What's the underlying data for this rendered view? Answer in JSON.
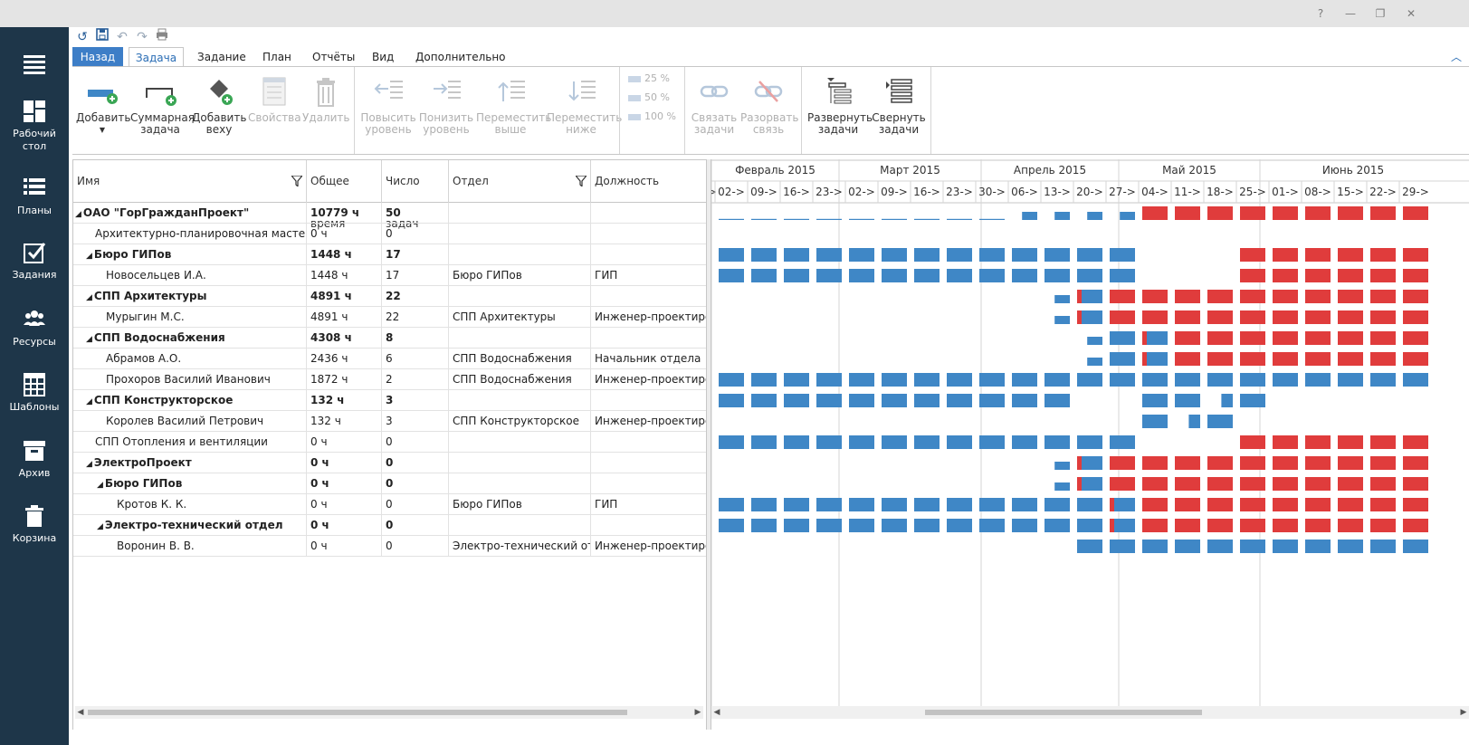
{
  "window": {
    "help_glyph": "?",
    "minimize_glyph": "—",
    "restore_glyph": "❐",
    "close_glyph": "✕"
  },
  "sidebar": {
    "items": [
      {
        "label": "",
        "icon": "hamburger-menu-icon"
      },
      {
        "label": "Рабочий стол",
        "icon": "dashboard-icon"
      },
      {
        "label": "Планы",
        "icon": "list-icon"
      },
      {
        "label": "Задания",
        "icon": "checkbox-icon"
      },
      {
        "label": "Ресурсы",
        "icon": "people-icon"
      },
      {
        "label": "Шаблоны",
        "icon": "table-template-icon"
      },
      {
        "label": "Архив",
        "icon": "archive-icon"
      },
      {
        "label": "Корзина",
        "icon": "trash-icon"
      }
    ]
  },
  "quick_access": [
    "refresh-icon",
    "save-icon",
    "undo-icon",
    "redo-icon",
    "print-icon"
  ],
  "tabs": {
    "back": "Назад",
    "items": [
      "Задача",
      "Задание",
      "План",
      "Отчёты",
      "Вид",
      "Дополнительно"
    ],
    "active": "Задача"
  },
  "ribbon": {
    "add": "Добавить",
    "summary_task_1": "Суммарная",
    "summary_task_2": "задача",
    "add_milestone_1": "Добавить",
    "add_milestone_2": "веху",
    "properties": "Свойства",
    "delete": "Удалить",
    "indent_1": "Повысить",
    "indent_2": "уровень",
    "outdent_1": "Понизить",
    "outdent_2": "уровень",
    "move_up_1": "Переместить",
    "move_up_2": "выше",
    "move_down_1": "Переместить",
    "move_down_2": "ниже",
    "pct_25": "25 %",
    "pct_50": "50 %",
    "pct_100": "100 %",
    "link_1": "Связать",
    "link_2": "задачи",
    "unlink_1": "Разорвать",
    "unlink_2": "связь",
    "expand_1": "Развернуть",
    "expand_2": "задачи",
    "collapse_1": "Свернуть",
    "collapse_2": "задачи"
  },
  "grid": {
    "columns": {
      "name": "Имя",
      "total_time": "Общее время",
      "task_count": "Число задач",
      "department": "Отдел",
      "position": "Должность"
    },
    "rows": [
      {
        "name": "ОАО \"ГорГражданПроект\"",
        "time": "10779 ч",
        "count": "50",
        "dept": "",
        "pos": ""
      },
      {
        "name": "Архитектурно-планировочная мастерская",
        "time": "0 ч",
        "count": "0",
        "dept": "",
        "pos": ""
      },
      {
        "name": "Бюро ГИПов",
        "time": "1448 ч",
        "count": "17",
        "dept": "",
        "pos": ""
      },
      {
        "name": "Новосельцев И.А.",
        "time": "1448 ч",
        "count": "17",
        "dept": "Бюро ГИПов",
        "pos": "ГИП"
      },
      {
        "name": "СПП Архитектуры",
        "time": "4891 ч",
        "count": "22",
        "dept": "",
        "pos": ""
      },
      {
        "name": "Мурыгин М.С.",
        "time": "4891 ч",
        "count": "22",
        "dept": "СПП Архитектуры",
        "pos": "Инженер-проектировщ"
      },
      {
        "name": "СПП Водоснабжения",
        "time": "4308 ч",
        "count": "8",
        "dept": "",
        "pos": ""
      },
      {
        "name": "Абрамов А.О.",
        "time": "2436 ч",
        "count": "6",
        "dept": "СПП Водоснабжения",
        "pos": "Начальник отдела"
      },
      {
        "name": "Прохоров Василий Иванович",
        "time": "1872 ч",
        "count": "2",
        "dept": "СПП Водоснабжения",
        "pos": "Инженер-проектировщ"
      },
      {
        "name": "СПП Конструкторское",
        "time": "132 ч",
        "count": "3",
        "dept": "",
        "pos": ""
      },
      {
        "name": "Королев Василий Петрович",
        "time": "132 ч",
        "count": "3",
        "dept": "СПП Конструкторское",
        "pos": "Инженер-проектировщ"
      },
      {
        "name": "СПП Отопления и вентиляции",
        "time": "0 ч",
        "count": "0",
        "dept": "",
        "pos": ""
      },
      {
        "name": "ЭлектроПроект",
        "time": "0 ч",
        "count": "0",
        "dept": "",
        "pos": ""
      },
      {
        "name": "Бюро ГИПов",
        "time": "0 ч",
        "count": "0",
        "dept": "",
        "pos": ""
      },
      {
        "name": "Кротов К. К.",
        "time": "0 ч",
        "count": "0",
        "dept": "Бюро ГИПов",
        "pos": "ГИП"
      },
      {
        "name": "Электро-технический отдел",
        "time": "0 ч",
        "count": "0",
        "dept": "",
        "pos": ""
      },
      {
        "name": "Воронин В. В.",
        "time": "0 ч",
        "count": "0",
        "dept": "Электро-технический отдел",
        "pos": "Инженер-проектировщ"
      }
    ]
  },
  "gantt": {
    "colors": {
      "normal": "#3f87c6",
      "overload": "#e03c3c"
    },
    "months": [
      "Февраль 2015",
      "Март 2015",
      "Апрель 2015",
      "Май 2015",
      "Июнь 2015"
    ],
    "first_week_label": ">",
    "weeks": [
      "02->",
      "09->",
      "16->",
      "23->",
      "02->",
      "09->",
      "16->",
      "23->",
      "30->",
      "06->",
      "13->",
      "20->",
      "27->",
      "04->",
      "11->",
      "18->",
      "25->",
      "01->",
      "08->",
      "15->",
      "22->",
      "29->"
    ]
  }
}
